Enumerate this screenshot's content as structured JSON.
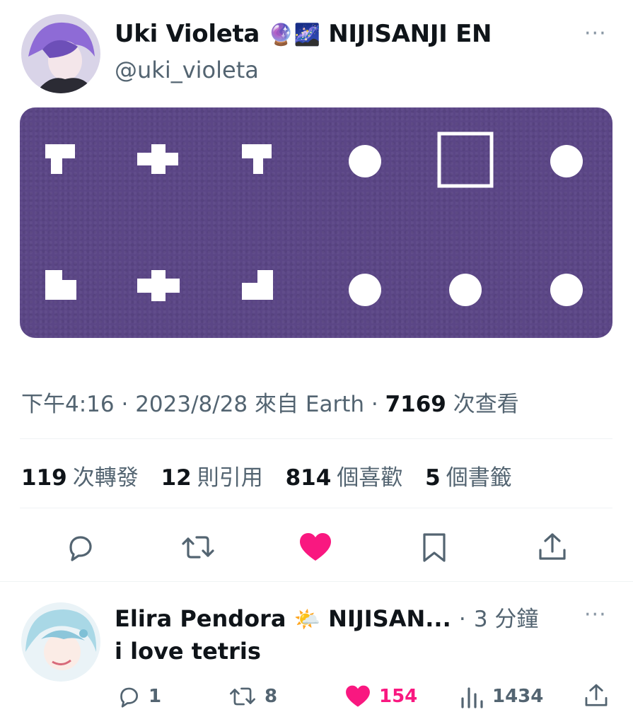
{
  "tweet": {
    "author_name": "Uki Violeta",
    "author_emojis": "🔮🌌",
    "author_affiliation": "NIJISANJI EN",
    "handle": "@uki_violeta",
    "time": "下午4:16",
    "date": "2023/8/28",
    "source_prefix": "來自",
    "source": "Earth",
    "views": "7169",
    "views_label": "次查看",
    "stats": {
      "retweets": "119",
      "retweets_label": "次轉發",
      "quotes": "12",
      "quotes_label": "則引用",
      "likes": "814",
      "likes_label": "個喜歡",
      "bookmarks": "5",
      "bookmarks_label": "個書籤"
    },
    "more_label": "···"
  },
  "reply": {
    "author_name": "Elira Pendora",
    "author_emoji": "🌤️",
    "author_affiliation": "NIJISAN...",
    "time": "3 分鐘",
    "text": "i love tetris",
    "replies": "1",
    "retweets": "8",
    "likes": "154",
    "views": "1434",
    "more_label": "···"
  },
  "colors": {
    "banner": "#5b4686",
    "like_active": "#f91880",
    "secondary_text": "#536471"
  }
}
